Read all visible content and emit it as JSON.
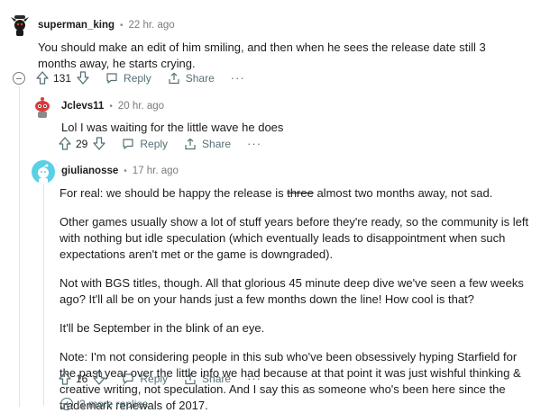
{
  "comments": [
    {
      "username": "superman_king",
      "dot": "•",
      "time": "22 hr. ago",
      "paragraphs": [
        "You should make an edit of him smiling, and then when he sees the release date still 3 months away, he starts crying."
      ],
      "score": "131",
      "reply": "Reply",
      "share": "Share",
      "more": "···"
    },
    {
      "username": "Jclevs11",
      "dot": "•",
      "time": "20 hr. ago",
      "paragraphs": [
        "Lol I was waiting for the little wave he does"
      ],
      "score": "29",
      "reply": "Reply",
      "share": "Share",
      "more": "···"
    },
    {
      "username": "giulianosse",
      "dot": "•",
      "time": "17 hr. ago",
      "p1_before": "For real: we should be happy the release is ",
      "p1_strike": "three",
      "p1_after": " almost two months away, not sad.",
      "paragraphs": [
        "Other games usually show a lot of stuff years before they're ready, so the community is left with nothing but idle speculation (which eventually leads to disappointment when such expectations aren't met or the game is downgraded).",
        "Not with BGS titles, though. All that glorious 45 minute deep dive we've seen a few weeks ago? It'll all be on your hands just a few months down the line! How cool is that?",
        "It'll be September in the blink of an eye.",
        "Note: I'm not considering people in this sub who've been obsessively hyping Starfield for the past year over the little info we had because at that point it was just wishful thinking & creative writing, not speculation. And I say this as someone who's been here since the trademark renewals of 2017."
      ],
      "score": "16",
      "reply": "Reply",
      "share": "Share",
      "more": "···"
    }
  ],
  "more_replies": "2 more replies",
  "colors": {
    "text": "#1c1c1c",
    "meta": "#576f76",
    "thread_line": "#dfe3e6",
    "avatar3_bg": "#59d0e6"
  },
  "icons": [
    "reddit-snoo-avatar-icon",
    "upvote-icon",
    "downvote-icon",
    "reply-icon",
    "share-icon",
    "more-options-icon",
    "collapse-icon",
    "expand-icon"
  ]
}
